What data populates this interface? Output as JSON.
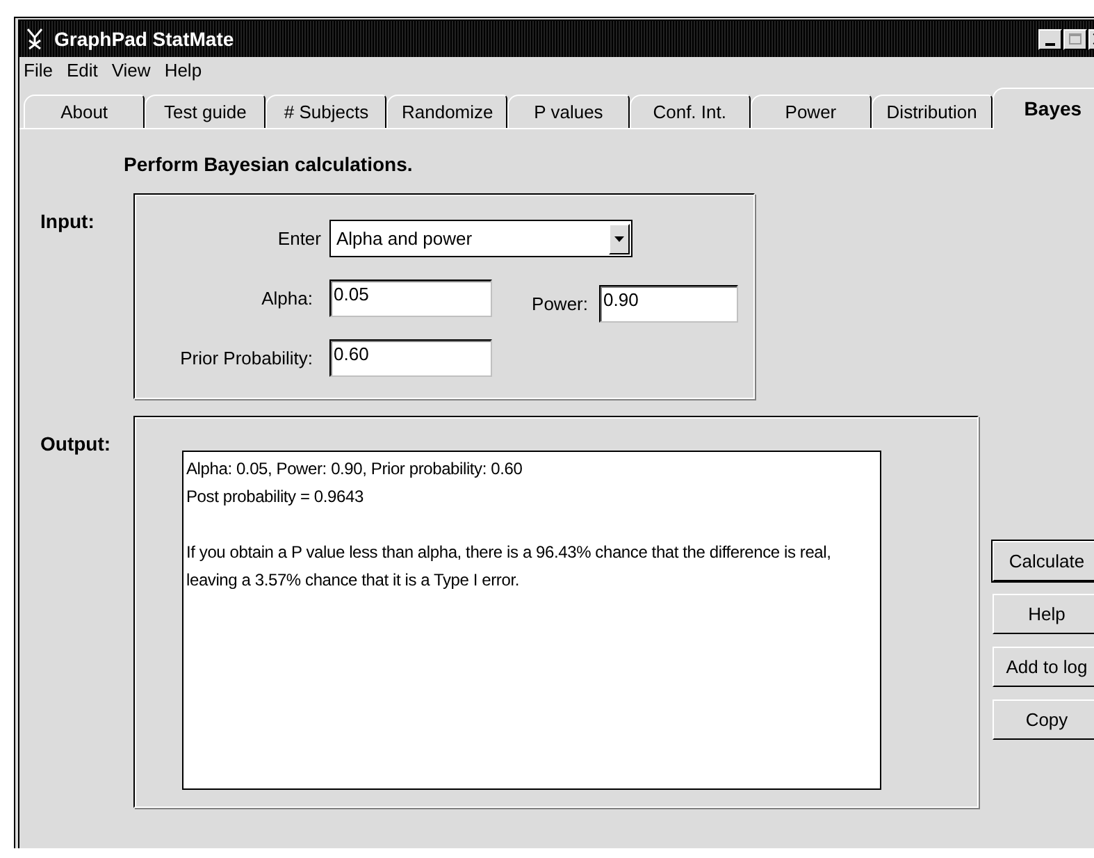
{
  "window": {
    "title": "GraphPad StatMate"
  },
  "menu": [
    "File",
    "Edit",
    "View",
    "Help"
  ],
  "tabs": [
    {
      "label": "About",
      "selected": false
    },
    {
      "label": "Test guide",
      "selected": false
    },
    {
      "label": "# Subjects",
      "selected": false
    },
    {
      "label": "Randomize",
      "selected": false
    },
    {
      "label": "P values",
      "selected": false
    },
    {
      "label": "Conf. Int.",
      "selected": false
    },
    {
      "label": "Power",
      "selected": false
    },
    {
      "label": "Distribution",
      "selected": false
    },
    {
      "label": "Bayes",
      "selected": true
    }
  ],
  "heading": "Perform Bayesian calculations.",
  "input": {
    "label": "Input:",
    "enter_label": "Enter",
    "enter_value": "Alpha and power",
    "alpha_label": "Alpha:",
    "alpha_value": "0.05",
    "power_label": "Power:",
    "power_value": "0.90",
    "prior_label": "Prior Probability:",
    "prior_value": "0.60"
  },
  "output": {
    "label": "Output:",
    "paragraphs": [
      [
        "Alpha: 0.05, Power: 0.90, Prior probability: 0.60",
        "Post probability = 0.9643"
      ],
      [
        "If you obtain a P value less than alpha, there is a 96.43% chance that the difference is real, leaving a 3.57% chance that it is a Type I error."
      ]
    ]
  },
  "buttons": [
    {
      "label": "Calculate",
      "default": true
    },
    {
      "label": "Help",
      "default": false
    },
    {
      "label": "Add to log",
      "default": false
    },
    {
      "label": "Copy",
      "default": false
    }
  ]
}
